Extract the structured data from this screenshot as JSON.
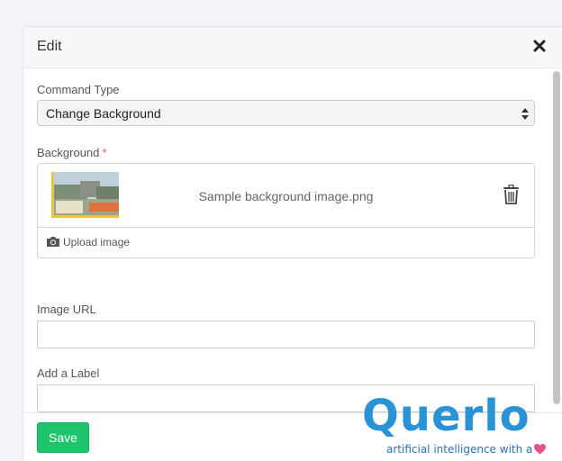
{
  "modal": {
    "title": "Edit"
  },
  "command_type": {
    "label": "Command Type",
    "selected": "Change Background"
  },
  "background": {
    "label": "Background",
    "required_marker": "*",
    "file_name": "Sample background image.png",
    "upload_label": "Upload image"
  },
  "image_url": {
    "label": "Image URL",
    "value": ""
  },
  "add_label": {
    "label": "Add a Label",
    "value": ""
  },
  "footer": {
    "save_label": "Save"
  },
  "logo": {
    "word": "Querlo",
    "tagline": "artificial intelligence with a"
  },
  "colors": {
    "save": "#1ec46b",
    "brand_blue": "#2a93d5",
    "required": "#e05a4f",
    "heart": "#e8508b"
  },
  "icons": [
    "close-icon",
    "select-arrows-icon",
    "trash-icon",
    "camera-icon",
    "heart-icon"
  ]
}
